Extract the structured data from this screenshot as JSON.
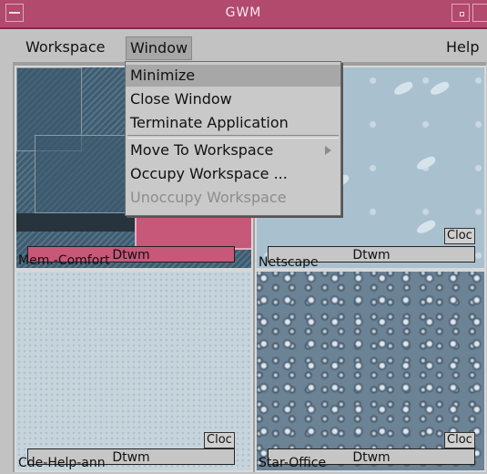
{
  "window": {
    "title": "GWM"
  },
  "menubar": {
    "items": [
      {
        "label": "Workspace"
      },
      {
        "label": "Window"
      },
      {
        "label": "Help"
      }
    ]
  },
  "dropdown": {
    "items": [
      {
        "label": "Minimize",
        "selected": true
      },
      {
        "label": "Close Window"
      },
      {
        "label": "Terminate Application"
      },
      {
        "label": "Move To Workspace"
      },
      {
        "label": "Occupy Workspace ..."
      },
      {
        "label": "Unoccupy Workspace",
        "disabled": true
      }
    ]
  },
  "workspaces": [
    {
      "label": "Mem.-Comfort",
      "button": "Dtwm",
      "clock": ""
    },
    {
      "label": "Netscape",
      "button": "Dtwm",
      "clock": "Cloc"
    },
    {
      "label": "Cde-Help-ann",
      "button": "Dtwm",
      "clock": "Cloc"
    },
    {
      "label": "Star-Office",
      "button": "Dtwm",
      "clock": "Cloc"
    }
  ],
  "colors": {
    "titlebar": "#b24a6e",
    "active_button": "#c8587a",
    "menu_bg": "#c9c9c9"
  }
}
